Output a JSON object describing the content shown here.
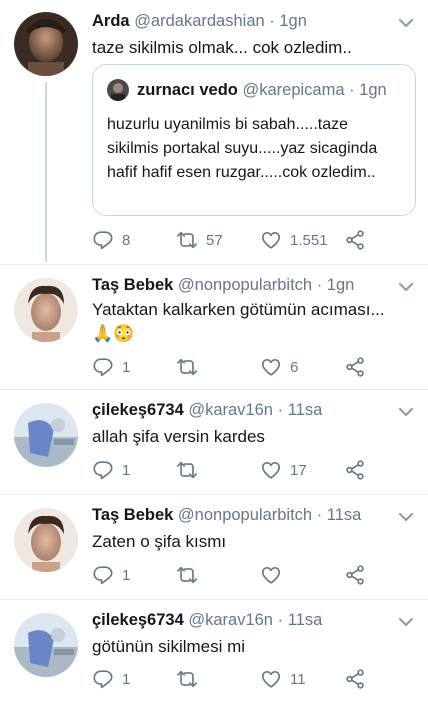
{
  "colors": {
    "text": "#14171a",
    "muted": "#657786",
    "border": "#ccd6dd"
  },
  "icons": [
    "reply-icon",
    "retweet-icon",
    "like-icon",
    "share-icon",
    "chevron-down-icon"
  ],
  "tweets": [
    {
      "name": "Arda",
      "handle": "@ardakardashian",
      "dot": "·",
      "time": "1gn",
      "text": "taze sikilmis olmak... cok ozledim..",
      "quote": {
        "name": "zurnacı vedo",
        "handle": "@karepicama",
        "dot": "·",
        "time": "1gn",
        "text": "huzurlu uyanilmis bi sabah.....taze sikilmis portakal suyu.....yaz sicaginda hafif hafif esen ruzgar.....cok ozledim.."
      },
      "replies": "8",
      "retweets": "57",
      "likes": "1.551"
    },
    {
      "name": "Taş Bebek",
      "handle": "@nonpopularbitch",
      "dot": "·",
      "time": "1gn",
      "text": "Yataktan kalkarken götümün acıması...",
      "emoji": "🙏😳",
      "replies": "1",
      "retweets": "",
      "likes": "6"
    },
    {
      "name": "çilekeş6734",
      "handle": "@karav16n",
      "dot": "·",
      "time": "11sa",
      "text": "allah şifa versin kardes",
      "replies": "1",
      "retweets": "",
      "likes": "17"
    },
    {
      "name": "Taş Bebek",
      "handle": "@nonpopularbitch",
      "dot": "·",
      "time": "11sa",
      "text": "Zaten o şifa kısmı",
      "replies": "1",
      "retweets": "",
      "likes": ""
    },
    {
      "name": "çilekeş6734",
      "handle": "@karav16n",
      "dot": "·",
      "time": "11sa",
      "text": "götünün sikilmesi mi",
      "replies": "1",
      "retweets": "",
      "likes": "11"
    }
  ]
}
